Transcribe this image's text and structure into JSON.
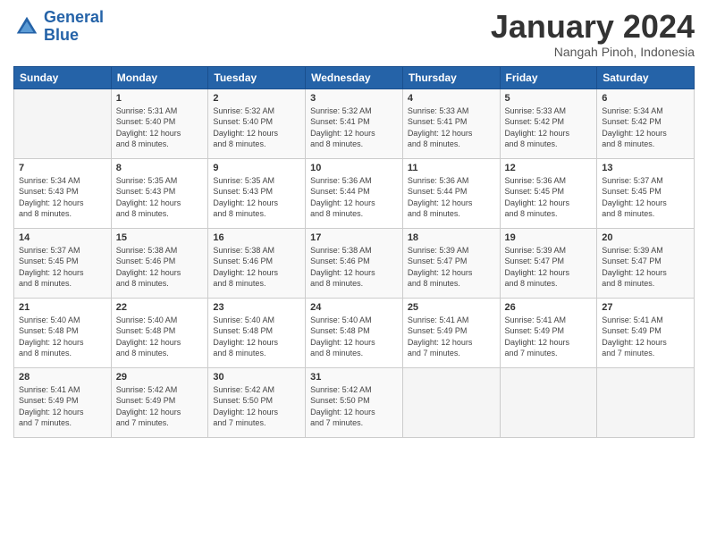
{
  "logo": {
    "line1": "General",
    "line2": "Blue"
  },
  "title": "January 2024",
  "location": "Nangah Pinoh, Indonesia",
  "days_of_week": [
    "Sunday",
    "Monday",
    "Tuesday",
    "Wednesday",
    "Thursday",
    "Friday",
    "Saturday"
  ],
  "weeks": [
    [
      {
        "day": "",
        "sunrise": "",
        "sunset": "",
        "daylight1": "",
        "daylight2": ""
      },
      {
        "day": "1",
        "sunrise": "Sunrise: 5:31 AM",
        "sunset": "Sunset: 5:40 PM",
        "daylight1": "Daylight: 12 hours",
        "daylight2": "and 8 minutes."
      },
      {
        "day": "2",
        "sunrise": "Sunrise: 5:32 AM",
        "sunset": "Sunset: 5:40 PM",
        "daylight1": "Daylight: 12 hours",
        "daylight2": "and 8 minutes."
      },
      {
        "day": "3",
        "sunrise": "Sunrise: 5:32 AM",
        "sunset": "Sunset: 5:41 PM",
        "daylight1": "Daylight: 12 hours",
        "daylight2": "and 8 minutes."
      },
      {
        "day": "4",
        "sunrise": "Sunrise: 5:33 AM",
        "sunset": "Sunset: 5:41 PM",
        "daylight1": "Daylight: 12 hours",
        "daylight2": "and 8 minutes."
      },
      {
        "day": "5",
        "sunrise": "Sunrise: 5:33 AM",
        "sunset": "Sunset: 5:42 PM",
        "daylight1": "Daylight: 12 hours",
        "daylight2": "and 8 minutes."
      },
      {
        "day": "6",
        "sunrise": "Sunrise: 5:34 AM",
        "sunset": "Sunset: 5:42 PM",
        "daylight1": "Daylight: 12 hours",
        "daylight2": "and 8 minutes."
      }
    ],
    [
      {
        "day": "7",
        "sunrise": "Sunrise: 5:34 AM",
        "sunset": "Sunset: 5:43 PM",
        "daylight1": "Daylight: 12 hours",
        "daylight2": "and 8 minutes."
      },
      {
        "day": "8",
        "sunrise": "Sunrise: 5:35 AM",
        "sunset": "Sunset: 5:43 PM",
        "daylight1": "Daylight: 12 hours",
        "daylight2": "and 8 minutes."
      },
      {
        "day": "9",
        "sunrise": "Sunrise: 5:35 AM",
        "sunset": "Sunset: 5:43 PM",
        "daylight1": "Daylight: 12 hours",
        "daylight2": "and 8 minutes."
      },
      {
        "day": "10",
        "sunrise": "Sunrise: 5:36 AM",
        "sunset": "Sunset: 5:44 PM",
        "daylight1": "Daylight: 12 hours",
        "daylight2": "and 8 minutes."
      },
      {
        "day": "11",
        "sunrise": "Sunrise: 5:36 AM",
        "sunset": "Sunset: 5:44 PM",
        "daylight1": "Daylight: 12 hours",
        "daylight2": "and 8 minutes."
      },
      {
        "day": "12",
        "sunrise": "Sunrise: 5:36 AM",
        "sunset": "Sunset: 5:45 PM",
        "daylight1": "Daylight: 12 hours",
        "daylight2": "and 8 minutes."
      },
      {
        "day": "13",
        "sunrise": "Sunrise: 5:37 AM",
        "sunset": "Sunset: 5:45 PM",
        "daylight1": "Daylight: 12 hours",
        "daylight2": "and 8 minutes."
      }
    ],
    [
      {
        "day": "14",
        "sunrise": "Sunrise: 5:37 AM",
        "sunset": "Sunset: 5:45 PM",
        "daylight1": "Daylight: 12 hours",
        "daylight2": "and 8 minutes."
      },
      {
        "day": "15",
        "sunrise": "Sunrise: 5:38 AM",
        "sunset": "Sunset: 5:46 PM",
        "daylight1": "Daylight: 12 hours",
        "daylight2": "and 8 minutes."
      },
      {
        "day": "16",
        "sunrise": "Sunrise: 5:38 AM",
        "sunset": "Sunset: 5:46 PM",
        "daylight1": "Daylight: 12 hours",
        "daylight2": "and 8 minutes."
      },
      {
        "day": "17",
        "sunrise": "Sunrise: 5:38 AM",
        "sunset": "Sunset: 5:46 PM",
        "daylight1": "Daylight: 12 hours",
        "daylight2": "and 8 minutes."
      },
      {
        "day": "18",
        "sunrise": "Sunrise: 5:39 AM",
        "sunset": "Sunset: 5:47 PM",
        "daylight1": "Daylight: 12 hours",
        "daylight2": "and 8 minutes."
      },
      {
        "day": "19",
        "sunrise": "Sunrise: 5:39 AM",
        "sunset": "Sunset: 5:47 PM",
        "daylight1": "Daylight: 12 hours",
        "daylight2": "and 8 minutes."
      },
      {
        "day": "20",
        "sunrise": "Sunrise: 5:39 AM",
        "sunset": "Sunset: 5:47 PM",
        "daylight1": "Daylight: 12 hours",
        "daylight2": "and 8 minutes."
      }
    ],
    [
      {
        "day": "21",
        "sunrise": "Sunrise: 5:40 AM",
        "sunset": "Sunset: 5:48 PM",
        "daylight1": "Daylight: 12 hours",
        "daylight2": "and 8 minutes."
      },
      {
        "day": "22",
        "sunrise": "Sunrise: 5:40 AM",
        "sunset": "Sunset: 5:48 PM",
        "daylight1": "Daylight: 12 hours",
        "daylight2": "and 8 minutes."
      },
      {
        "day": "23",
        "sunrise": "Sunrise: 5:40 AM",
        "sunset": "Sunset: 5:48 PM",
        "daylight1": "Daylight: 12 hours",
        "daylight2": "and 8 minutes."
      },
      {
        "day": "24",
        "sunrise": "Sunrise: 5:40 AM",
        "sunset": "Sunset: 5:48 PM",
        "daylight1": "Daylight: 12 hours",
        "daylight2": "and 8 minutes."
      },
      {
        "day": "25",
        "sunrise": "Sunrise: 5:41 AM",
        "sunset": "Sunset: 5:49 PM",
        "daylight1": "Daylight: 12 hours",
        "daylight2": "and 7 minutes."
      },
      {
        "day": "26",
        "sunrise": "Sunrise: 5:41 AM",
        "sunset": "Sunset: 5:49 PM",
        "daylight1": "Daylight: 12 hours",
        "daylight2": "and 7 minutes."
      },
      {
        "day": "27",
        "sunrise": "Sunrise: 5:41 AM",
        "sunset": "Sunset: 5:49 PM",
        "daylight1": "Daylight: 12 hours",
        "daylight2": "and 7 minutes."
      }
    ],
    [
      {
        "day": "28",
        "sunrise": "Sunrise: 5:41 AM",
        "sunset": "Sunset: 5:49 PM",
        "daylight1": "Daylight: 12 hours",
        "daylight2": "and 7 minutes."
      },
      {
        "day": "29",
        "sunrise": "Sunrise: 5:42 AM",
        "sunset": "Sunset: 5:49 PM",
        "daylight1": "Daylight: 12 hours",
        "daylight2": "and 7 minutes."
      },
      {
        "day": "30",
        "sunrise": "Sunrise: 5:42 AM",
        "sunset": "Sunset: 5:50 PM",
        "daylight1": "Daylight: 12 hours",
        "daylight2": "and 7 minutes."
      },
      {
        "day": "31",
        "sunrise": "Sunrise: 5:42 AM",
        "sunset": "Sunset: 5:50 PM",
        "daylight1": "Daylight: 12 hours",
        "daylight2": "and 7 minutes."
      },
      {
        "day": "",
        "sunrise": "",
        "sunset": "",
        "daylight1": "",
        "daylight2": ""
      },
      {
        "day": "",
        "sunrise": "",
        "sunset": "",
        "daylight1": "",
        "daylight2": ""
      },
      {
        "day": "",
        "sunrise": "",
        "sunset": "",
        "daylight1": "",
        "daylight2": ""
      }
    ]
  ]
}
